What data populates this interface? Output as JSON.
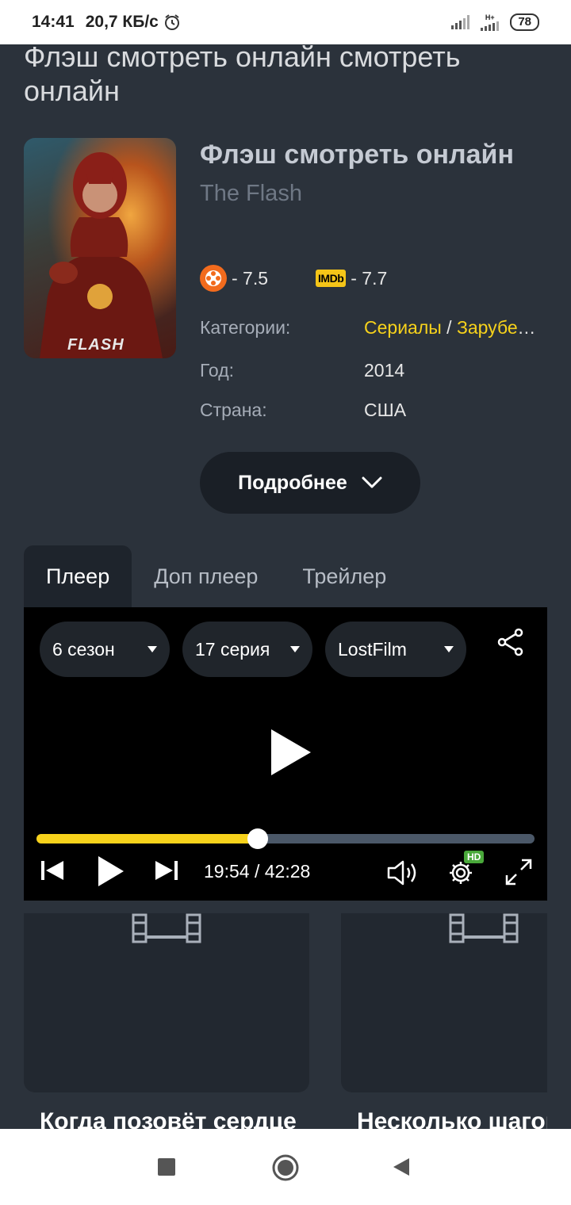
{
  "status_bar": {
    "time": "14:41",
    "speed": "20,7 КБ/с",
    "network": "H+",
    "battery": "78"
  },
  "page_title": "Флэш смотреть онлайн смотреть онлайн",
  "movie": {
    "title": "Флэш смотреть онлайн",
    "original_title": "The Flash",
    "poster_logo": "FLASH",
    "ratings": {
      "kinopoisk": "- 7.5",
      "imdb_label": "IMDb",
      "imdb": "- 7.7"
    },
    "meta": {
      "categories_label": "Категории:",
      "categories": [
        "Сериалы",
        "Зарубежные сериалы"
      ],
      "categories_sep": " / ",
      "year_label": "Год:",
      "year": "2014",
      "country_label": "Страна:",
      "country": "США"
    },
    "more_button": "Подробнее"
  },
  "tabs": [
    {
      "label": "Плеер",
      "active": true
    },
    {
      "label": "Доп плеер",
      "active": false
    },
    {
      "label": "Трейлер",
      "active": false
    }
  ],
  "player": {
    "season": "6 сезон",
    "episode": "17 серия",
    "voice": "LostFilm",
    "current_time": "19:54",
    "duration": "42:28",
    "progress": 0.445,
    "quality_badge": "HD",
    "accent_color": "#f7d21b"
  },
  "related": [
    {
      "title": "Когда позовёт сердце"
    },
    {
      "title": "Несколько шагов"
    }
  ],
  "icons": [
    "alarm-icon",
    "signal-icon",
    "kinopoisk-icon",
    "imdb-icon",
    "chevron-down-icon",
    "share-icon",
    "play-icon",
    "prev-icon",
    "next-icon",
    "volume-icon",
    "settings-icon",
    "fullscreen-icon",
    "film-icon",
    "recent-apps-icon",
    "home-icon",
    "back-icon"
  ]
}
